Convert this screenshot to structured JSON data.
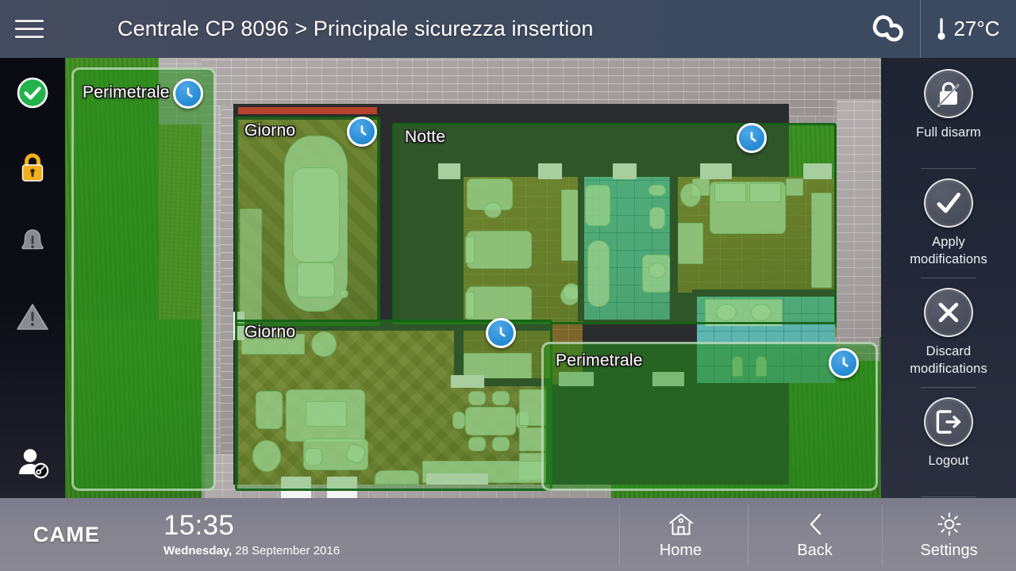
{
  "header": {
    "menu_icon": "hamburger-menu-icon",
    "title": "Centrale CP 8096 > Principale sicurezza insertion",
    "sync_icon": "cloud-sync-icon",
    "thermometer_icon": "thermometer-icon",
    "temperature": "27°C"
  },
  "left_rail": [
    {
      "name": "status-ok",
      "icon": "check-circle-icon",
      "color": "#23b24b"
    },
    {
      "name": "status-armed",
      "icon": "lock-icon",
      "color": "#f2b01e"
    },
    {
      "name": "status-alarm-bell",
      "icon": "bell-alert-icon",
      "color": "#8a8a92"
    },
    {
      "name": "status-warning",
      "icon": "warning-triangle-icon",
      "color": "#8a8a92"
    },
    {
      "name": "user-account",
      "icon": "user-key-icon",
      "color": "#ffffff"
    }
  ],
  "actions": [
    {
      "name": "full-disarm",
      "icon": "lock-slash-icon",
      "label": "Full disarm"
    },
    {
      "name": "apply-modifications",
      "icon": "check-icon",
      "label": "Apply\nmodifications",
      "line1": "Apply",
      "line2": "modifications"
    },
    {
      "name": "discard-modifications",
      "icon": "close-x-icon",
      "label": "Discard\nmodifications",
      "line1": "Discard",
      "line2": "modifications"
    },
    {
      "name": "logout",
      "icon": "logout-arrow-icon",
      "label": "Logout",
      "line1": "Logout",
      "line2": ""
    }
  ],
  "plan": {
    "zones": [
      {
        "name": "zone-perimetrale-left",
        "label": "Perimetrale",
        "badge_icon": "clock-icon",
        "state": "timed"
      },
      {
        "name": "zone-giorno-garage",
        "label": "Giorno",
        "badge_icon": "clock-icon",
        "state": "timed"
      },
      {
        "name": "zone-notte",
        "label": "Notte",
        "badge_icon": "clock-icon",
        "state": "timed"
      },
      {
        "name": "zone-notte-badge-right",
        "label": "",
        "badge_icon": "clock-icon",
        "state": "timed"
      },
      {
        "name": "zone-giorno-living",
        "label": "Giorno",
        "badge_icon": "clock-icon",
        "state": "timed"
      },
      {
        "name": "zone-perimetrale-garden",
        "label": "Perimetrale",
        "badge_icon": "clock-icon",
        "state": "timed"
      }
    ]
  },
  "bottom": {
    "brand": "CAME",
    "time": "15:35",
    "weekday": "Wednesday,",
    "date": "28 September 2016",
    "nav": [
      {
        "name": "home",
        "icon": "home-icon",
        "label": "Home"
      },
      {
        "name": "back",
        "icon": "chevron-left-icon",
        "label": "Back"
      },
      {
        "name": "settings",
        "icon": "gear-icon",
        "label": "Settings"
      }
    ]
  },
  "colors": {
    "header_bg": "#414859",
    "rail_bg": "#0b0c14",
    "right_rail_bg": "#242a39",
    "bottom_bg": "#85848f",
    "accent_blue": "#2b8fd6",
    "ok_green": "#23b24b",
    "lock_yellow": "#f2b01e",
    "zone_green": "#389624"
  }
}
